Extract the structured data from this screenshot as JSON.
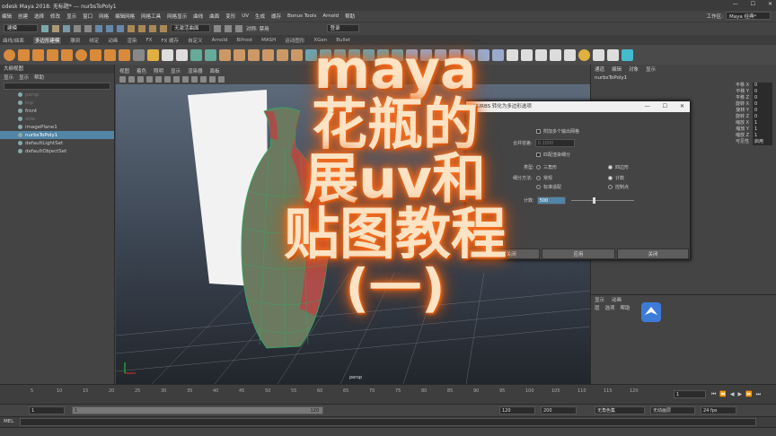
{
  "window": {
    "title": "odesk Maya 2018: 无标题*    ---    nurbsToPoly1",
    "controls": [
      "—",
      "☐",
      "✕"
    ]
  },
  "menubar": {
    "items": [
      "编辑",
      "创建",
      "选择",
      "修改",
      "显示",
      "窗口",
      "网格",
      "编辑网格",
      "网格工具",
      "网格显示",
      "曲线",
      "曲面",
      "变形",
      "UV",
      "生成",
      "缓存",
      "Bonus Tools",
      "Arnold",
      "帮助"
    ],
    "workspace_label": "工作区:",
    "workspace_value": "Maya 经典*"
  },
  "statusline": {
    "mode": "建模",
    "live_surface": "无激活曲面",
    "symmetry_label": "对称: 禁用",
    "login": "登录"
  },
  "shelf": {
    "tabs": [
      "曲线/曲面",
      "多边形建模",
      "雕刻",
      "绑定",
      "动画",
      "渲染",
      "FX",
      "FX 缓存",
      "自定义",
      "Arnold",
      "Bifrost",
      "MASH",
      "运动图形",
      "XGen",
      "Bullet"
    ],
    "active_tab": 1
  },
  "outliner": {
    "title": "大纲视图",
    "menu": [
      "显示",
      "显示",
      "帮助"
    ],
    "items": [
      {
        "label": "persp",
        "state": "dim"
      },
      {
        "label": "top",
        "state": "dim"
      },
      {
        "label": "front",
        "state": "normal"
      },
      {
        "label": "side",
        "state": "dim"
      },
      {
        "label": "imagePlane1",
        "state": "normal"
      },
      {
        "label": "nurbsToPoly1",
        "state": "selected"
      },
      {
        "label": "defaultLightSet",
        "state": "normal"
      },
      {
        "label": "defaultObjectSet",
        "state": "normal"
      }
    ]
  },
  "viewport": {
    "menu": [
      "视图",
      "着色",
      "照明",
      "显示",
      "渲染器",
      "面板"
    ],
    "camera_label": "persp"
  },
  "channelbox": {
    "menu": [
      "通道",
      "编辑",
      "对象",
      "显示"
    ],
    "object": "nurbsToPoly1",
    "attributes": [
      {
        "name": "平移 X",
        "value": "0"
      },
      {
        "name": "平移 Y",
        "value": "0"
      },
      {
        "name": "平移 Z",
        "value": "0"
      },
      {
        "name": "旋转 X",
        "value": "0"
      },
      {
        "name": "旋转 Y",
        "value": "0"
      },
      {
        "name": "旋转 Z",
        "value": "0"
      },
      {
        "name": "缩放 X",
        "value": "1"
      },
      {
        "name": "缩放 Y",
        "value": "1"
      },
      {
        "name": "缩放 Z",
        "value": "1"
      },
      {
        "name": "可见性",
        "value": "启用"
      }
    ]
  },
  "layer_editor": {
    "tabs": [
      "显示",
      "动画"
    ],
    "menu": [
      "层",
      "选项",
      "帮助"
    ]
  },
  "dialog": {
    "title": "NURBS 转化为多边形选项",
    "attach_label": "附加多个输出网格",
    "merge_label": "合并容差:",
    "merge_value": "0.1000",
    "match_label": "匹配渲染细分",
    "type_label": "类型:",
    "type_options": [
      "三角形",
      "四边形"
    ],
    "tess_label": "细分方法:",
    "tess_options": [
      "常规",
      "计数",
      "标准适配",
      "控制点"
    ],
    "count_label": "计数:",
    "count_value": "500",
    "count_fraction": 0.35,
    "buttons": [
      "应用并关闭",
      "应用",
      "关闭"
    ]
  },
  "overlay": {
    "line1": "maya",
    "line2": "花瓶的",
    "line3": "展uv和",
    "line4": "贴图教程",
    "line5": "(一)"
  },
  "timeline": {
    "ticks": [
      "5",
      "10",
      "15",
      "20",
      "25",
      "30",
      "35",
      "40",
      "45",
      "50",
      "55",
      "60",
      "65",
      "70",
      "75",
      "80",
      "85",
      "90",
      "95",
      "100",
      "105",
      "110",
      "115",
      "120"
    ],
    "current_frame": "1"
  },
  "range": {
    "start": "1",
    "inner_start": "1",
    "inner_start_b": "1",
    "inner_end": "120",
    "end_a": "120",
    "end_b": "200",
    "character_set": "无角色集",
    "anim_layer": "无动画层",
    "fps": "24 fps"
  },
  "cmd": {
    "label": "MEL"
  }
}
